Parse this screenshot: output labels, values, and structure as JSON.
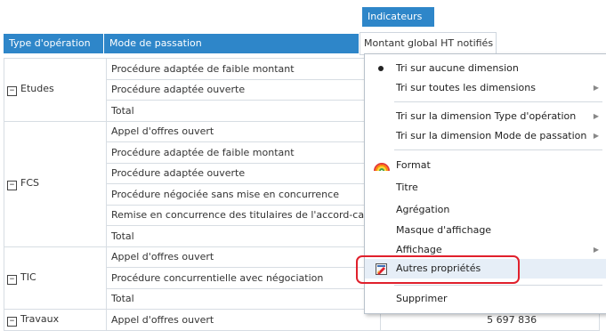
{
  "header": {
    "indicators_label": "Indicateurs",
    "col_type": "Type d'opération",
    "col_mode": "Mode de passation",
    "col_montant": "Montant global HT notifiés"
  },
  "rows": [
    {
      "group": "Etudes",
      "mode": "Procédure adaptée de faible montant"
    },
    {
      "group": "",
      "mode": "Procédure adaptée ouverte"
    },
    {
      "group": "",
      "mode": "Total"
    },
    {
      "group": "FCS",
      "mode": "Appel d'offres ouvert"
    },
    {
      "group": "",
      "mode": "Procédure adaptée de faible montant"
    },
    {
      "group": "",
      "mode": "Procédure adaptée ouverte"
    },
    {
      "group": "",
      "mode": "Procédure négociée sans mise en concurrence"
    },
    {
      "group": "",
      "mode": "Remise en concurrence des titulaires de l'accord-cadre"
    },
    {
      "group": "",
      "mode": "Total"
    },
    {
      "group": "TIC",
      "mode": "Appel d'offres ouvert"
    },
    {
      "group": "",
      "mode": "Procédure concurrentielle avec négociation"
    },
    {
      "group": "",
      "mode": "Total"
    },
    {
      "group": "Travaux",
      "mode": "Appel d'offres ouvert",
      "value": "5 697 836"
    }
  ],
  "toggle_symbol": "−",
  "menu": {
    "tri_aucune": "Tri sur aucune dimension",
    "tri_toutes": "Tri sur toutes les dimensions",
    "tri_type": "Tri sur la dimension Type d'opération",
    "tri_mode": "Tri sur la dimension Mode de passation",
    "format": "Format",
    "titre": "Titre",
    "agregation": "Agrégation",
    "masque": "Masque d'affichage",
    "affichage": "Affichage",
    "autres": "Autres propriétés",
    "supprimer": "Supprimer"
  },
  "colors": {
    "header_blue": "#2e86c9",
    "highlight_red": "#e0202c"
  }
}
